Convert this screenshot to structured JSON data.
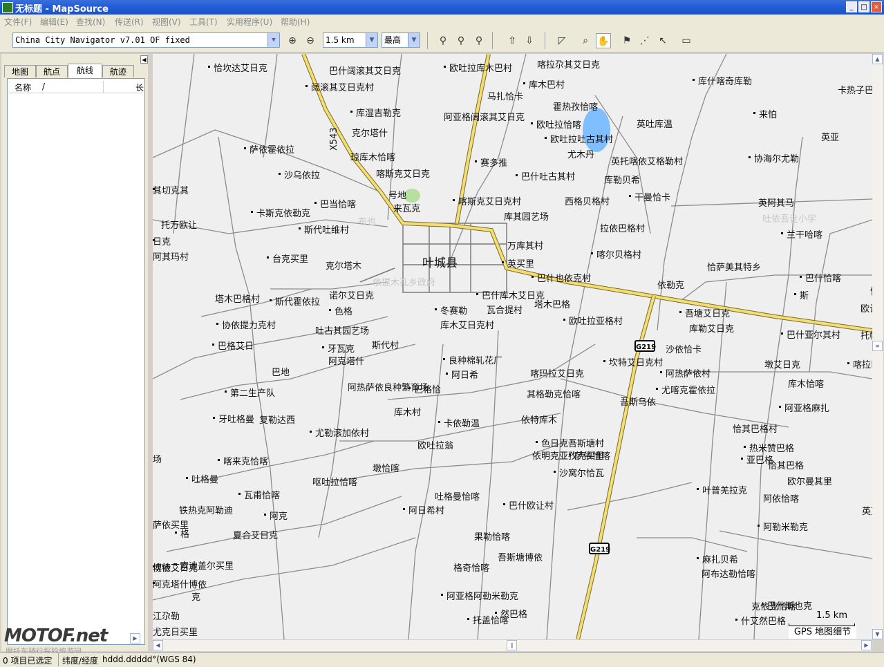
{
  "window": {
    "title": "无标题 - MapSource",
    "min": "_",
    "max": "□",
    "close": "×"
  },
  "menu": [
    "文件(F)",
    "编辑(E)",
    "查找(N)",
    "传送(R)",
    "视图(V)",
    "工具(T)",
    "实用程序(U)",
    "帮助(H)"
  ],
  "toolbar": {
    "map_product": "China City Navigator v7.01 OF fixed",
    "zoom_scale": "1.5 km",
    "detail": "最高"
  },
  "left_panel": {
    "tabs": [
      "地图",
      "航点",
      "航线",
      "航迹"
    ],
    "active_tab": "航线",
    "columns": [
      "名称",
      "/",
      "长"
    ]
  },
  "map": {
    "city_label": "叶城县",
    "road_shields": [
      "G219",
      "G219"
    ],
    "road_ref": "X543",
    "faint_labels": [
      "布也",
      "依提木孔乡政府",
      "吐依吾让小学",
      "伯西热克乡"
    ],
    "places": [
      "恰坎达艾日克",
      "巴什阔滚其艾日克",
      "欧吐拉库木巴村",
      "喀拉尕其艾日克",
      "库什喀奇库勒",
      "卡热子巴",
      "阔滚其艾日克村",
      "马扎恰卡",
      "库木巴村",
      "霍热孜恰喀",
      "库湿吉勒克",
      "阿亚格阔滚其艾日克",
      "欧吐拉恰喀",
      "英吐库温",
      "来怕",
      "克尔塔什",
      "欧吐拉吐古其村",
      "英亚",
      "萨依霍依拉",
      "尤木丹",
      "协海尔尤勒",
      "琼库木恰喀",
      "赛多推",
      "英托喀依艾格勒村",
      "沙乌依拉",
      "喀斯克艾日克",
      "巴什吐古其村",
      "库勒贝希",
      "其切克其",
      "号地",
      "喀斯克艾日克村",
      "西格贝格村",
      "干曼恰卡",
      "英阿其马",
      "巴当恰喀",
      "来瓦克",
      "卡斯克依勒克",
      "库其园艺场",
      "斯代吐维村",
      "拉依巴格村",
      "兰干哈喀",
      "托万欧让",
      "日克",
      "万库其村",
      "喀尔贝格村",
      "阿其玛村",
      "台克买里",
      "克尔塔木",
      "英买里",
      "恰萨美其特乡",
      "巴什也依克村",
      "依勒克",
      "巴什恰喀",
      "塔木巴格村",
      "斯代霍依拉",
      "诺尔艾日克",
      "巴什库木艾日克",
      "恰萨",
      "斯",
      "塔木巴格",
      "冬赛勒",
      "瓦合提村",
      "吾塘艾日克",
      "欧让园艺场",
      "色格",
      "库勒艾日克",
      "协依提力克村",
      "库木艾日克村",
      "欧吐拉亚格村",
      "吐古其园艺场",
      "巴什亚尔其村",
      "托帕克恰喀",
      "巴格艾日",
      "斯代村",
      "牙瓦克",
      "沙依恰卡",
      "良种棉轧花厂",
      "阿克塔什",
      "坎特艾日克村",
      "墩艾日克",
      "喀拉巴格村",
      "巴地",
      "阿日希",
      "喀玛拉艾日克",
      "阿热萨依村",
      "阿热萨依良种繁育场",
      "巴格恰",
      "其格勒克恰喀",
      "尤喀克霍依拉",
      "库木恰喀",
      "第二生产队",
      "吾斯乌依",
      "阿亚格麻扎",
      "库木村",
      "牙吐格曼",
      "复勒达西",
      "卡依勒温",
      "依特库木",
      "尤勒滚加依村",
      "恰其巴格村",
      "色日克吾斯塘村",
      "欧吐拉翁",
      "热米赞巴格",
      "依明克亚孜克买里",
      "亚巴格",
      "场",
      "萨依恰喀",
      "恰其巴格",
      "喀来克恰喀",
      "墩恰喀",
      "沙窝尔恰瓦",
      "欧尔曼其里",
      "吐格曼",
      "呕吐拉恰喀",
      "瓦甫恰喀",
      "吐格曼恰喀",
      "叶普羌拉克",
      "阿依恰喀",
      "巴什欧让村",
      "铁热克阿勒迪",
      "阿日希村",
      "英艾日克菜队",
      "阿克",
      "萨依买里",
      "格",
      "夏合艾日克",
      "阿勒米勒克",
      "果勒恰喀",
      "坎特艾日克",
      "吾斯塘博依",
      "麻扎贝希",
      "博依",
      "索迪盖尔买里",
      "格奇恰喀",
      "阿克塔什博依",
      "克",
      "阿亚格阿勒米勒克",
      "阿布达勒恰喀",
      "巴什斯也克",
      "江尕勒",
      "然巴格",
      "克依克恰喀",
      "托盖恰喀",
      "尤克日买里",
      "什艾然巴格"
    ],
    "scale_label": "1.5 km",
    "info_label": "GPS 地图细节"
  },
  "status": {
    "selection": "0 项目已选定",
    "coords_label": "纬度/经度",
    "coords_value": "hddd.ddddd°(WGS 84)"
  },
  "watermark": {
    "brand": "MOTOF.net",
    "sub": "摩托车骑行探险旅游网"
  },
  "colors": {
    "titlebar": "#245edb",
    "map_bg": "#efefef",
    "main_road": "#f4e07a",
    "road_edge": "#8a8a8a",
    "water": "#7fbfff"
  }
}
